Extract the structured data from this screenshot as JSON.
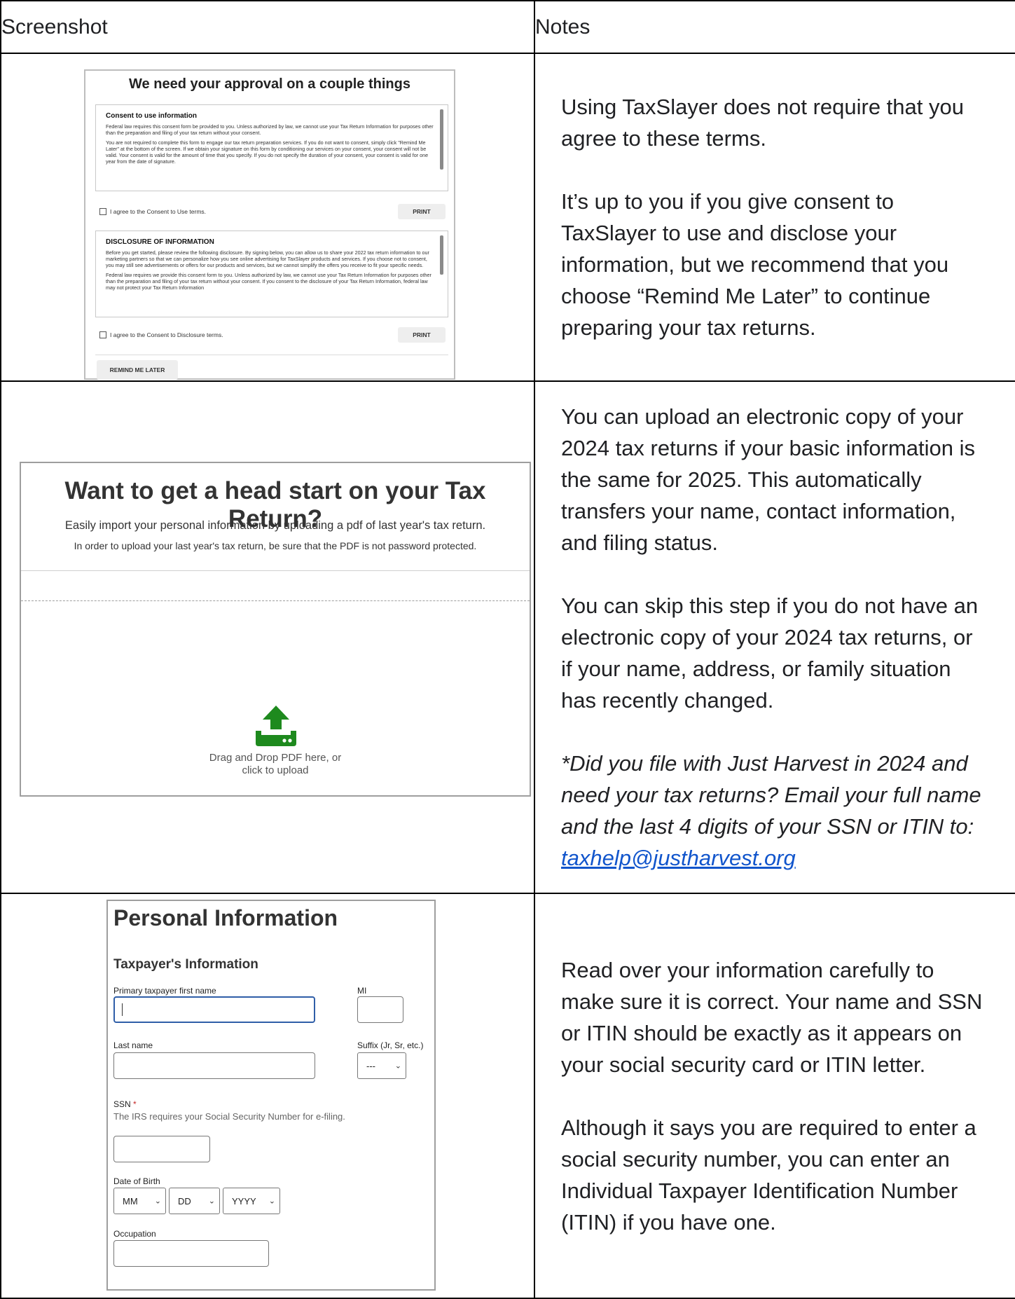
{
  "header": {
    "col1": "Screenshot",
    "col2": "Notes"
  },
  "row1": {
    "shot": {
      "title": "We need your approval on a couple things",
      "consent_title": "Consent to use information",
      "consent_p1": "Federal law requires this consent form be provided to you. Unless authorized by law, we cannot use your Tax Return Information for purposes other than the preparation and filing of your tax return without your consent.",
      "consent_p2": "You are not required to complete this form to engage our tax return preparation services. If you do not want to consent, simply click \"Remind Me Later\" at the bottom of the screen. If we obtain your signature on this form by conditioning our services on your consent, your consent will not be valid. Your consent is valid for the amount of time that you specify. If you do not specify the duration of your consent, your consent is valid for one year from the date of signature.",
      "agree_use": "I agree to the Consent to Use terms.",
      "print1": "PRINT",
      "disclosure_title": "DISCLOSURE OF INFORMATION",
      "disclosure_p1": "Before you get started, please review the following disclosure. By signing below, you can allow us to share your 2022 tax return information to our marketing partners so that we can personalize how you see online advertising for TaxSlayer products and services. If you choose not to consent, you may still see advertisements or offers for our products and services, but we cannot simplify the offers you receive to fit your specific needs.",
      "disclosure_p2": "Federal law requires we provide this consent form to you. Unless authorized by law, we cannot use your Tax Return Information for purposes other than the preparation and filing of your tax return without your consent. If you consent to the disclosure of your Tax Return Information, federal law may not protect your Tax Return Information",
      "agree_disclosure": "I agree to the Consent to Disclosure terms.",
      "print2": "PRINT",
      "remind": "REMIND ME LATER"
    },
    "notes_p1": "Using TaxSlayer does not require that you agree to these terms.",
    "notes_p2": "It’s up to you if you give consent to TaxSlayer to use and disclose your information, but we recommend that you choose “Remind Me Later” to continue preparing your tax returns."
  },
  "row2": {
    "shot": {
      "title": "Want to get a head start on your Tax Return?",
      "sub1": "Easily import your personal information by uploading a pdf of last year's tax return.",
      "sub2": "In order to upload your last year's tax return, be sure that the PDF is not password protected.",
      "drop1": "Drag and Drop PDF here, or",
      "drop2": "click to upload",
      "icon": "upload-icon",
      "icon_color": "#1e8a1e"
    },
    "notes_p1": "You can upload an electronic copy of your 2024 tax returns if your basic information is the same for 2025.  This automatically transfers your name, contact information, and filing status.",
    "notes_p2": "You can skip this step if  you do not have an electronic copy of your 2024 tax returns, or if  your name, address, or  family situation has recently changed.",
    "notes_p3": "*Did you file with Just Harvest in 2024 and need your tax returns?  Email your full name and the last 4 digits of your SSN or ITIN to: ",
    "email": "taxhelp@justharvest.org"
  },
  "row3": {
    "shot": {
      "title": "Personal Information",
      "section": "Taxpayer's Information",
      "first_name_label": "Primary taxpayer first name",
      "mi_label": "MI",
      "last_name_label": "Last name",
      "suffix_label": "Suffix (Jr, Sr, etc.)",
      "suffix_value": "---",
      "ssn_label": "SSN",
      "ssn_required": "*",
      "ssn_hint": "The IRS requires your Social Security Number for e-filing.",
      "dob_label": "Date of Birth",
      "dob_month": "MM",
      "dob_day": "DD",
      "dob_year": "YYYY",
      "occupation_label": "Occupation"
    },
    "notes_p1": "Read over your information carefully to make sure it is correct.  Your name and SSN or ITIN should be exactly as it appears on your social security card or ITIN letter.",
    "notes_p2": "Although it says you are required to enter a social security number, you can enter an Individual Taxpayer Identification Number (ITIN) if you have one."
  }
}
